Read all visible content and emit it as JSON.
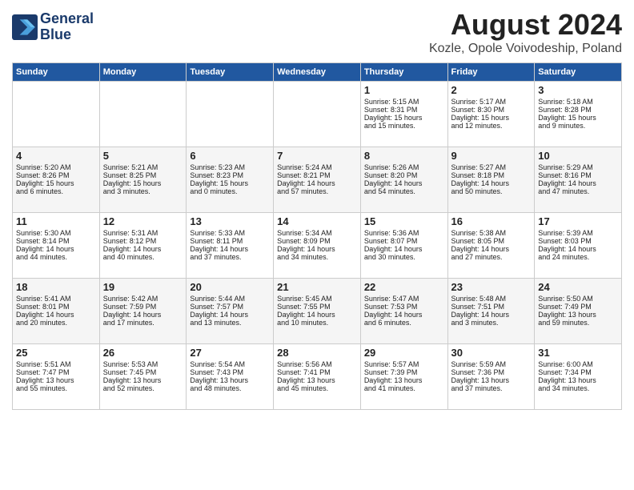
{
  "logo": {
    "line1": "General",
    "line2": "Blue"
  },
  "title": "August 2024",
  "subtitle": "Kozle, Opole Voivodeship, Poland",
  "headers": [
    "Sunday",
    "Monday",
    "Tuesday",
    "Wednesday",
    "Thursday",
    "Friday",
    "Saturday"
  ],
  "weeks": [
    [
      {
        "day": "",
        "text": ""
      },
      {
        "day": "",
        "text": ""
      },
      {
        "day": "",
        "text": ""
      },
      {
        "day": "",
        "text": ""
      },
      {
        "day": "1",
        "text": "Sunrise: 5:15 AM\nSunset: 8:31 PM\nDaylight: 15 hours\nand 15 minutes."
      },
      {
        "day": "2",
        "text": "Sunrise: 5:17 AM\nSunset: 8:30 PM\nDaylight: 15 hours\nand 12 minutes."
      },
      {
        "day": "3",
        "text": "Sunrise: 5:18 AM\nSunset: 8:28 PM\nDaylight: 15 hours\nand 9 minutes."
      }
    ],
    [
      {
        "day": "4",
        "text": "Sunrise: 5:20 AM\nSunset: 8:26 PM\nDaylight: 15 hours\nand 6 minutes."
      },
      {
        "day": "5",
        "text": "Sunrise: 5:21 AM\nSunset: 8:25 PM\nDaylight: 15 hours\nand 3 minutes."
      },
      {
        "day": "6",
        "text": "Sunrise: 5:23 AM\nSunset: 8:23 PM\nDaylight: 15 hours\nand 0 minutes."
      },
      {
        "day": "7",
        "text": "Sunrise: 5:24 AM\nSunset: 8:21 PM\nDaylight: 14 hours\nand 57 minutes."
      },
      {
        "day": "8",
        "text": "Sunrise: 5:26 AM\nSunset: 8:20 PM\nDaylight: 14 hours\nand 54 minutes."
      },
      {
        "day": "9",
        "text": "Sunrise: 5:27 AM\nSunset: 8:18 PM\nDaylight: 14 hours\nand 50 minutes."
      },
      {
        "day": "10",
        "text": "Sunrise: 5:29 AM\nSunset: 8:16 PM\nDaylight: 14 hours\nand 47 minutes."
      }
    ],
    [
      {
        "day": "11",
        "text": "Sunrise: 5:30 AM\nSunset: 8:14 PM\nDaylight: 14 hours\nand 44 minutes."
      },
      {
        "day": "12",
        "text": "Sunrise: 5:31 AM\nSunset: 8:12 PM\nDaylight: 14 hours\nand 40 minutes."
      },
      {
        "day": "13",
        "text": "Sunrise: 5:33 AM\nSunset: 8:11 PM\nDaylight: 14 hours\nand 37 minutes."
      },
      {
        "day": "14",
        "text": "Sunrise: 5:34 AM\nSunset: 8:09 PM\nDaylight: 14 hours\nand 34 minutes."
      },
      {
        "day": "15",
        "text": "Sunrise: 5:36 AM\nSunset: 8:07 PM\nDaylight: 14 hours\nand 30 minutes."
      },
      {
        "day": "16",
        "text": "Sunrise: 5:38 AM\nSunset: 8:05 PM\nDaylight: 14 hours\nand 27 minutes."
      },
      {
        "day": "17",
        "text": "Sunrise: 5:39 AM\nSunset: 8:03 PM\nDaylight: 14 hours\nand 24 minutes."
      }
    ],
    [
      {
        "day": "18",
        "text": "Sunrise: 5:41 AM\nSunset: 8:01 PM\nDaylight: 14 hours\nand 20 minutes."
      },
      {
        "day": "19",
        "text": "Sunrise: 5:42 AM\nSunset: 7:59 PM\nDaylight: 14 hours\nand 17 minutes."
      },
      {
        "day": "20",
        "text": "Sunrise: 5:44 AM\nSunset: 7:57 PM\nDaylight: 14 hours\nand 13 minutes."
      },
      {
        "day": "21",
        "text": "Sunrise: 5:45 AM\nSunset: 7:55 PM\nDaylight: 14 hours\nand 10 minutes."
      },
      {
        "day": "22",
        "text": "Sunrise: 5:47 AM\nSunset: 7:53 PM\nDaylight: 14 hours\nand 6 minutes."
      },
      {
        "day": "23",
        "text": "Sunrise: 5:48 AM\nSunset: 7:51 PM\nDaylight: 14 hours\nand 3 minutes."
      },
      {
        "day": "24",
        "text": "Sunrise: 5:50 AM\nSunset: 7:49 PM\nDaylight: 13 hours\nand 59 minutes."
      }
    ],
    [
      {
        "day": "25",
        "text": "Sunrise: 5:51 AM\nSunset: 7:47 PM\nDaylight: 13 hours\nand 55 minutes."
      },
      {
        "day": "26",
        "text": "Sunrise: 5:53 AM\nSunset: 7:45 PM\nDaylight: 13 hours\nand 52 minutes."
      },
      {
        "day": "27",
        "text": "Sunrise: 5:54 AM\nSunset: 7:43 PM\nDaylight: 13 hours\nand 48 minutes."
      },
      {
        "day": "28",
        "text": "Sunrise: 5:56 AM\nSunset: 7:41 PM\nDaylight: 13 hours\nand 45 minutes."
      },
      {
        "day": "29",
        "text": "Sunrise: 5:57 AM\nSunset: 7:39 PM\nDaylight: 13 hours\nand 41 minutes."
      },
      {
        "day": "30",
        "text": "Sunrise: 5:59 AM\nSunset: 7:36 PM\nDaylight: 13 hours\nand 37 minutes."
      },
      {
        "day": "31",
        "text": "Sunrise: 6:00 AM\nSunset: 7:34 PM\nDaylight: 13 hours\nand 34 minutes."
      }
    ]
  ]
}
